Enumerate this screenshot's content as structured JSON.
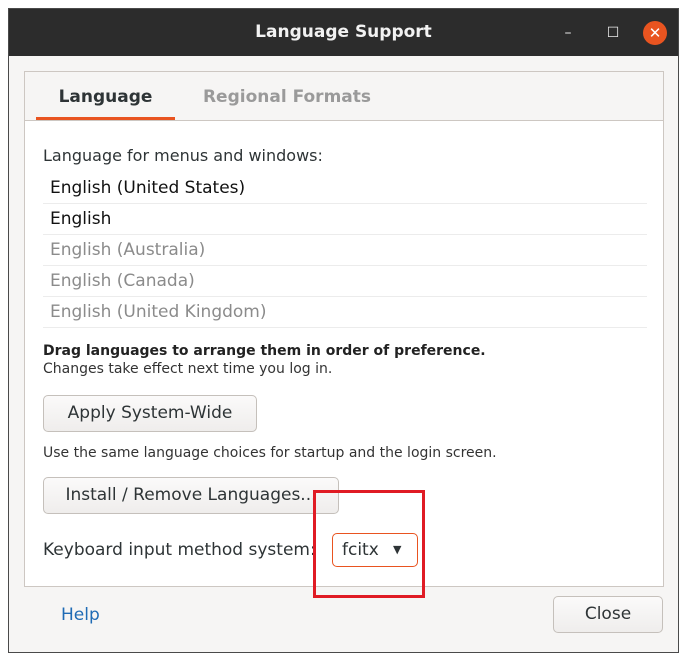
{
  "window": {
    "title": "Language Support",
    "minimize_glyph": "–",
    "maximize_glyph": "☐",
    "close_glyph": "✕"
  },
  "tabs": [
    {
      "label": "Language",
      "active": true
    },
    {
      "label": "Regional Formats",
      "active": false
    }
  ],
  "language_tab": {
    "section_label": "Language for menus and windows:",
    "languages": [
      {
        "label": "English (United States)",
        "enabled": true
      },
      {
        "label": "English",
        "enabled": true
      },
      {
        "label": "English (Australia)",
        "enabled": false
      },
      {
        "label": "English (Canada)",
        "enabled": false
      },
      {
        "label": "English (United Kingdom)",
        "enabled": false
      }
    ],
    "drag_hint": "Drag languages to arrange them in order of preference.",
    "effect_hint": "Changes take effect next time you log in.",
    "apply_button": "Apply System-Wide",
    "apply_hint": "Use the same language choices for startup and the login screen.",
    "install_button": "Install / Remove Languages...",
    "keyboard_label": "Keyboard input method system:",
    "keyboard_value": "fcitx",
    "keyboard_arrow": "▼"
  },
  "footer": {
    "help_label": "Help",
    "close_label": "Close"
  },
  "colors": {
    "accent": "#e95420",
    "highlight": "#e01b24",
    "link": "#1f6bb5"
  }
}
